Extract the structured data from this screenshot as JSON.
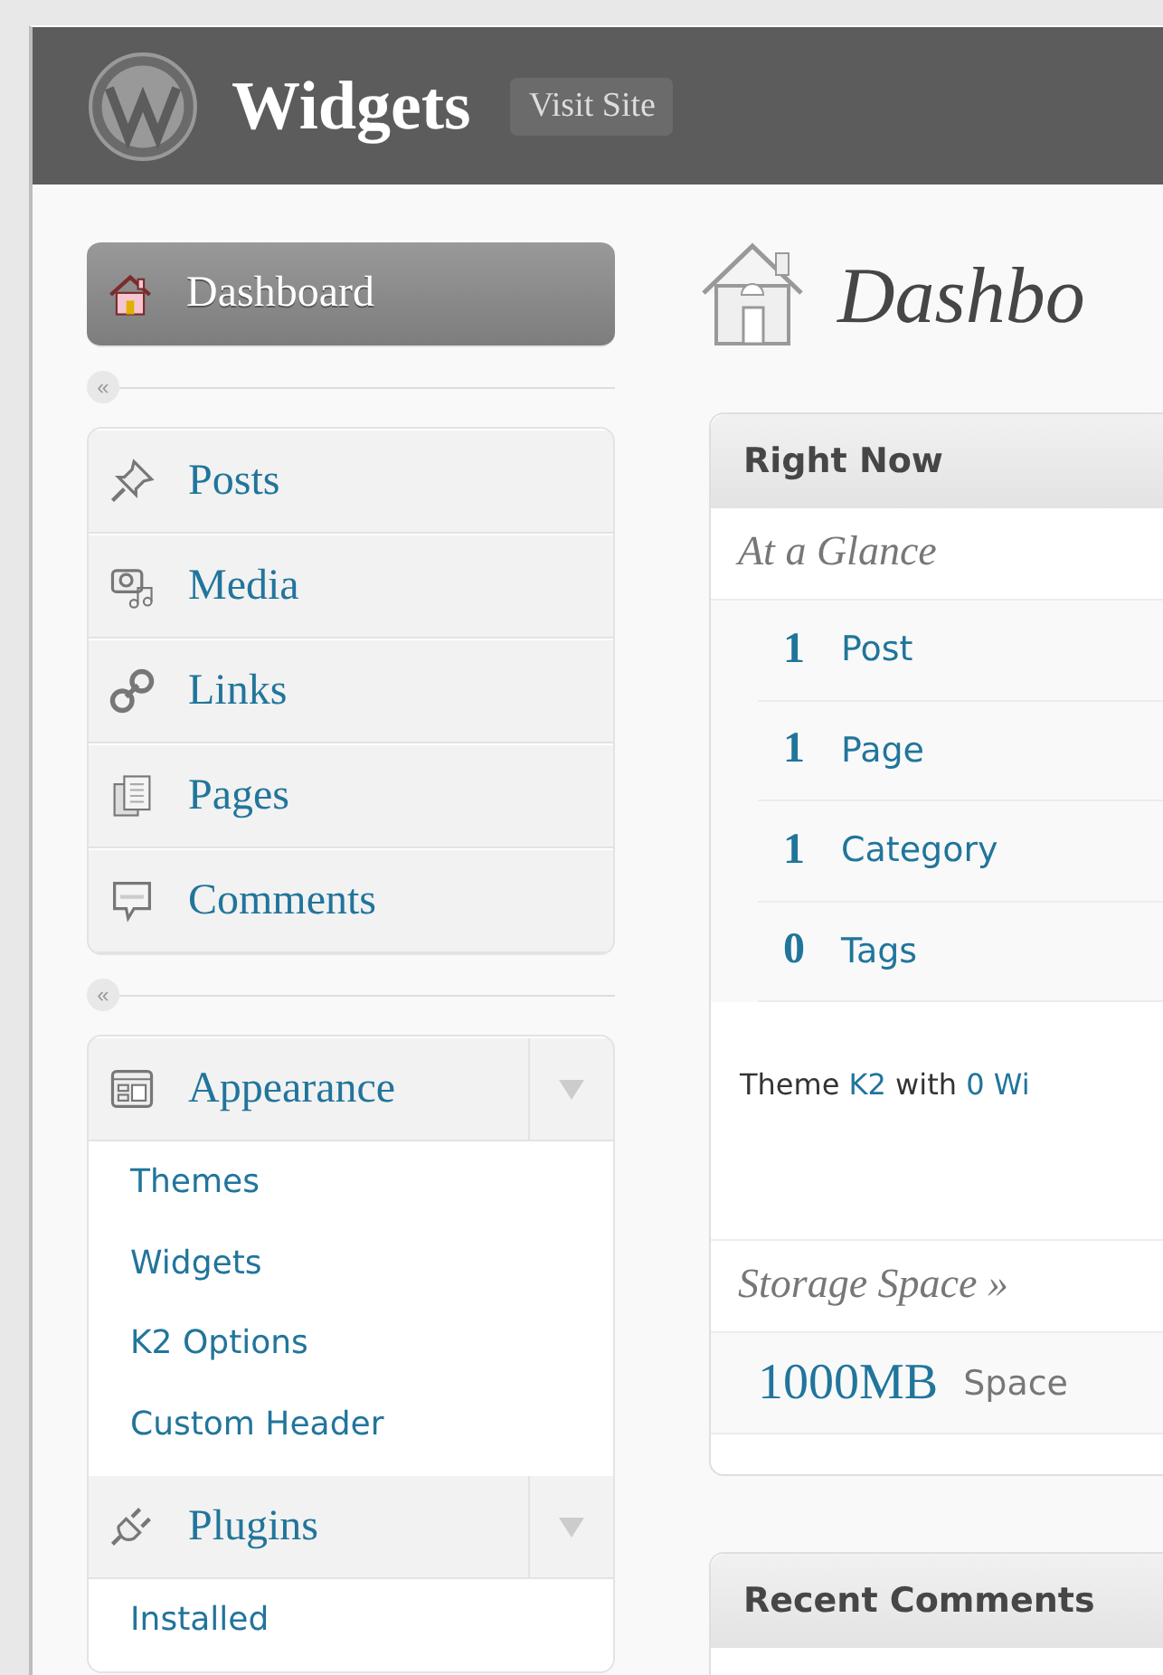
{
  "header": {
    "title": "Widgets",
    "visit_site": "Visit Site"
  },
  "sidebar": {
    "separators": [
      "«",
      "«"
    ],
    "groups": [
      {
        "items": [
          {
            "label": "Dashboard",
            "selected": true
          }
        ]
      },
      {
        "items": [
          {
            "label": "Posts",
            "selected": false
          },
          {
            "label": "Media",
            "selected": false
          },
          {
            "label": "Links",
            "selected": false
          },
          {
            "label": "Pages",
            "selected": false
          },
          {
            "label": "Comments",
            "selected": false
          }
        ]
      },
      {
        "items": [
          {
            "label": "Appearance",
            "selected": false,
            "expanded": true,
            "children": [
              "Themes",
              "Widgets",
              "K2 Options",
              "Custom Header"
            ]
          },
          {
            "label": "Plugins",
            "selected": false,
            "expanded": true,
            "children": [
              "Installed"
            ]
          }
        ]
      }
    ]
  },
  "main": {
    "page_title": "Dashbo",
    "right_now": {
      "title": "Right Now",
      "subtitle": "At a Glance",
      "counts": [
        {
          "number": "1",
          "label": "Post"
        },
        {
          "number": "1",
          "label": "Page"
        },
        {
          "number": "1",
          "label": "Category"
        },
        {
          "number": "0",
          "label": "Tags"
        }
      ],
      "theme_line": [
        {
          "kind": "plain",
          "text": "Theme"
        },
        {
          "kind": "link",
          "text": "K2"
        },
        {
          "kind": "plain",
          "text": "with"
        },
        {
          "kind": "link",
          "text": "0 Wi"
        }
      ],
      "storage_title": "Storage Space »",
      "storage_amount": "1000MB",
      "storage_label": "Space"
    },
    "recent_comments": {
      "title": "Recent Comments"
    }
  }
}
